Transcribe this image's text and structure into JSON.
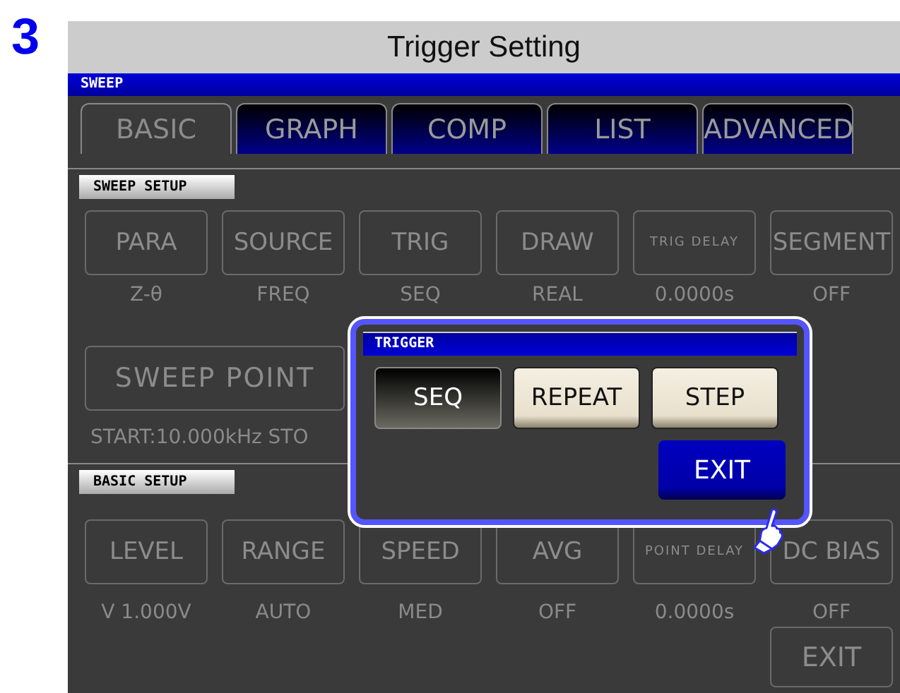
{
  "step_number": "3",
  "title": "Trigger Setting",
  "screen_header": "SWEEP",
  "tabs": [
    {
      "label": "BASIC",
      "selected": true
    },
    {
      "label": "GRAPH",
      "selected": false
    },
    {
      "label": "COMP",
      "selected": false
    },
    {
      "label": "LIST",
      "selected": false
    },
    {
      "label": "ADVANCED",
      "selected": false
    }
  ],
  "sweep_setup": {
    "label": "SWEEP SETUP",
    "settings": [
      {
        "button": "PARA",
        "value": "Z-θ",
        "kind": "normal"
      },
      {
        "button": "SOURCE",
        "value": "FREQ",
        "kind": "normal"
      },
      {
        "button": "TRIG",
        "value": "SEQ",
        "kind": "normal"
      },
      {
        "button": "DRAW",
        "value": "REAL",
        "kind": "normal"
      },
      {
        "button": "TRIG DELAY",
        "value": "0.0000s",
        "kind": "small"
      },
      {
        "button": "SEGMENT",
        "value": "OFF",
        "kind": "normal"
      }
    ],
    "sweep_point": "SWEEP POINT",
    "range_text": "START:10.000kHz STO"
  },
  "basic_setup": {
    "label": "BASIC SETUP",
    "settings": [
      {
        "button": "LEVEL",
        "value": "V 1.000V",
        "kind": "normal"
      },
      {
        "button": "RANGE",
        "value": "AUTO",
        "kind": "normal"
      },
      {
        "button": "SPEED",
        "value": "MED",
        "kind": "normal"
      },
      {
        "button": "AVG",
        "value": "OFF",
        "kind": "normal"
      },
      {
        "button": "POINT DELAY",
        "value": "0.0000s",
        "kind": "small"
      },
      {
        "button": "DC BIAS",
        "value": "OFF",
        "kind": "normal"
      }
    ]
  },
  "exit_button": "EXIT",
  "dialog": {
    "title": "TRIGGER",
    "options": [
      {
        "label": "SEQ",
        "selected": true
      },
      {
        "label": "REPEAT",
        "selected": false
      },
      {
        "label": "STEP",
        "selected": false
      }
    ],
    "exit": "EXIT"
  }
}
